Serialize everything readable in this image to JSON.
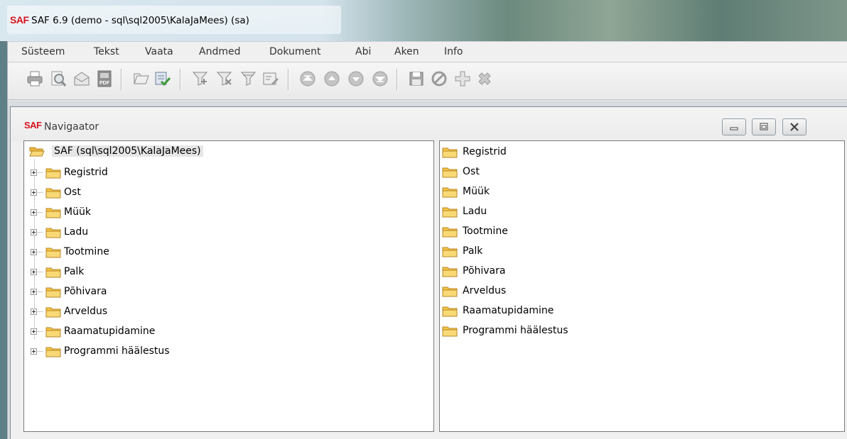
{
  "app": {
    "logo": "SAF",
    "title": "SAF 6.9 (demo - sql\\sql2005\\KalaJaMees) (sa)"
  },
  "menu": [
    "Süsteem",
    "Tekst",
    "Vaata",
    "Andmed",
    "Dokument",
    "Abi",
    "Aken",
    "Info"
  ],
  "toolbar": {
    "icons": [
      "print-icon",
      "print-preview-icon",
      "email-icon",
      "pdf-icon",
      "open-icon",
      "approve-icon",
      "filter-add-icon",
      "filter-remove-icon",
      "filter-icon",
      "filter-edit-icon",
      "first-record-icon",
      "previous-record-icon",
      "next-record-icon",
      "last-record-icon",
      "save-icon",
      "cancel-icon",
      "add-icon",
      "delete-icon"
    ]
  },
  "navigator": {
    "logo": "SAF",
    "title": "Navigaator",
    "tree_root": "SAF (sql\\sql2005\\KalaJaMees)",
    "tree_items": [
      "Registrid",
      "Ost",
      "Müük",
      "Ladu",
      "Tootmine",
      "Palk",
      "Põhivara",
      "Arveldus",
      "Raamatupidamine",
      "Programmi häälestus"
    ],
    "list_items": [
      "Registrid",
      "Ost",
      "Müük",
      "Ladu",
      "Tootmine",
      "Palk",
      "Põhivara",
      "Arveldus",
      "Raamatupidamine",
      "Programmi häälestus"
    ]
  },
  "colors": {
    "logo_red": "#d6141c",
    "folder_yellow": "#f5c542",
    "selection_gray": "#e6e6e6"
  }
}
